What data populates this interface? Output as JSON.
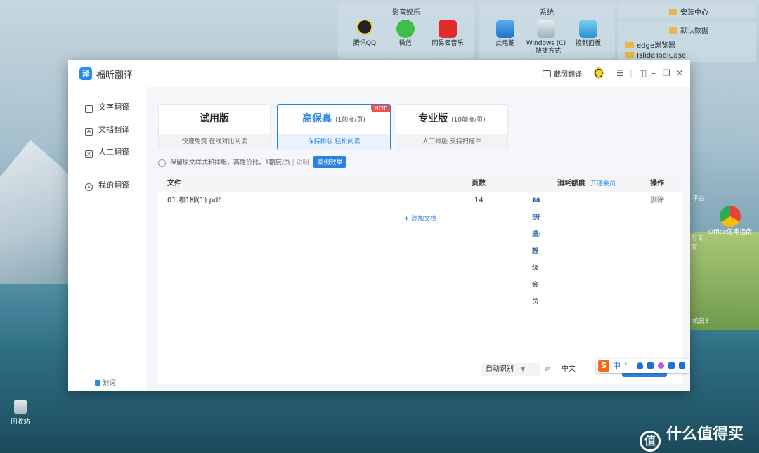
{
  "desktop": {
    "groups": [
      {
        "title": "影音娱乐",
        "icons": [
          "腾讯QQ",
          "微信",
          "网易云音乐"
        ]
      },
      {
        "title": "系统",
        "icons": [
          "此电脑",
          "Windows (C) - 快捷方式",
          "控制面板"
        ]
      }
    ],
    "right_panel": {
      "title": "安装中心",
      "subtitle": "默认数据",
      "folders": [
        "edge浏览器",
        "IslideToolCase"
      ]
    },
    "right_labels": [
      "平台",
      "万专 家",
      "Office效率指南",
      "机日3"
    ],
    "recycle_bin": "回收站"
  },
  "window": {
    "app_title": "福昕翻译",
    "logo_char": "译",
    "screenshot_translate": "截图翻译",
    "sidebar": {
      "items": [
        {
          "label": "文字翻译",
          "icon": "T"
        },
        {
          "label": "文档翻译",
          "icon": "A"
        },
        {
          "label": "人工翻译",
          "icon": "文"
        },
        {
          "label": "我的翻译",
          "icon": "人"
        }
      ],
      "footer_checkbox": "划词"
    },
    "plans": [
      {
        "title": "试用版",
        "quota": "",
        "subtitle": "快速免费 在线对比阅读",
        "active": false
      },
      {
        "title": "高保真",
        "quota": "(1额度/页)",
        "subtitle": "保持排版 轻松阅读",
        "active": true,
        "badge": "HOT"
      },
      {
        "title": "专业版",
        "quota": "(10额度/页)",
        "subtitle": "人工排版 支持扫描件",
        "active": false
      }
    ],
    "note": {
      "text": "保留原文样式和排版，高性价比，1额度/页",
      "sep": "|",
      "explain": "说明",
      "case_button": "案例效果"
    },
    "table": {
      "headers": {
        "file": "文件",
        "pages": "页数",
        "cost": "消耗额度",
        "member_link": "开通会员",
        "action": "操作"
      },
      "rows": [
        {
          "file": "01.咖1即(1).pdf",
          "pages": "14",
          "cost_prefix": "14 (开通超级会员",
          "cost_link": "80额度/天",
          "cost_suffix": ")",
          "action": "删除"
        }
      ],
      "add_doc": "+ 添加文档"
    },
    "language_bar": {
      "source": "自动识别",
      "swap": "⇌",
      "target": "中文"
    }
  },
  "ime": {
    "logo": "S",
    "mode": "中",
    "punct": "°,"
  },
  "watermark": {
    "text": "什么值得买",
    "logo": "值"
  }
}
